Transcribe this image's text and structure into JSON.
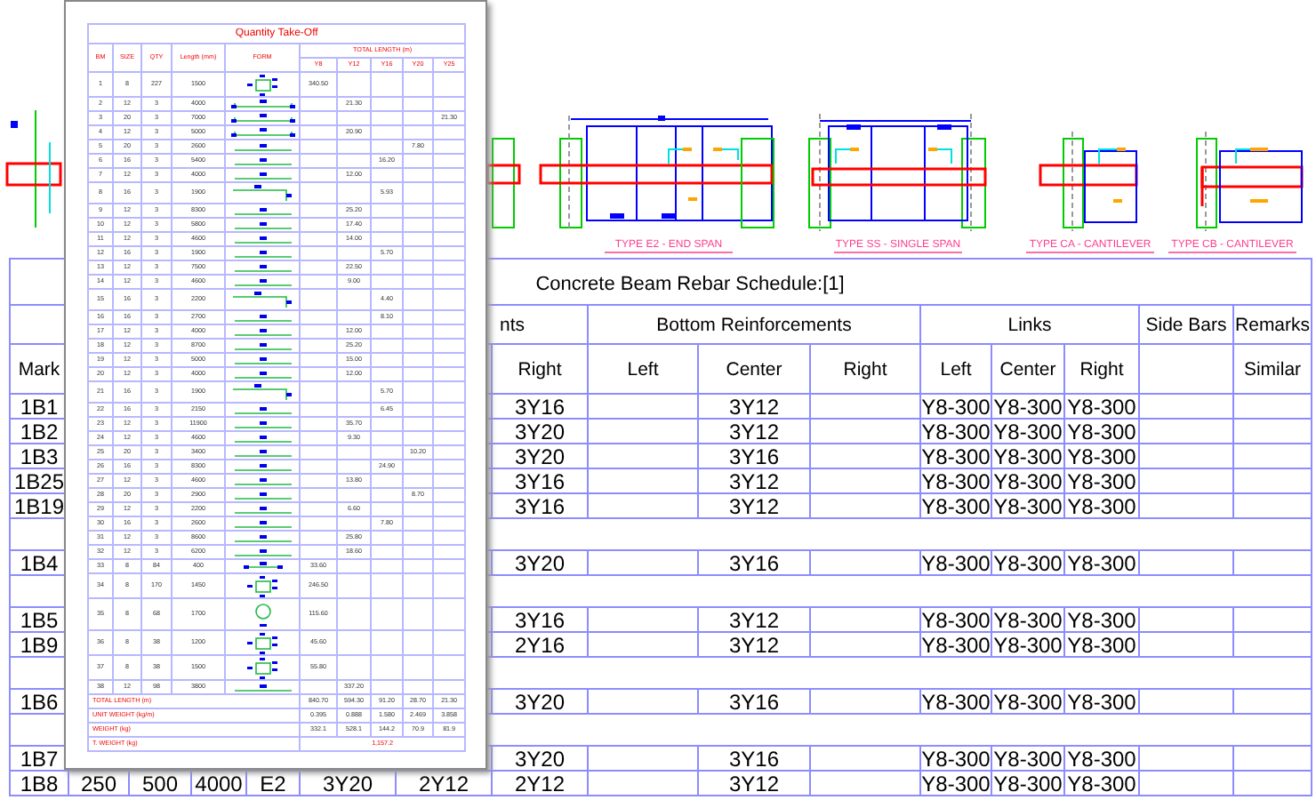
{
  "details": [
    {
      "label": "TYPE E2 - END SPAN"
    },
    {
      "label": "TYPE SS - SINGLE SPAN"
    },
    {
      "label": "TYPE CA - CANTILEVER"
    },
    {
      "label": "TYPE CB - CANTILEVER"
    }
  ],
  "schedule": {
    "title": "Concrete Beam Rebar Schedule:[1]",
    "group_headers": [
      "nts",
      "Bottom Reinforcements",
      "Links",
      "Side Bars",
      "Remarks"
    ],
    "column_headers": {
      "mark": "Mark",
      "top_right": "Right",
      "bottom_left": "Left",
      "bottom_center": "Center",
      "bottom_right": "Right",
      "links_left": "Left",
      "links_center": "Center",
      "links_right": "Right",
      "remarks": "Similar"
    },
    "rows": [
      {
        "kind": "data",
        "mark": "1B1",
        "top_right": "3Y16",
        "bottom_center": "3Y12",
        "links_left": "Y8-300",
        "links_center": "Y8-300",
        "links_right": "Y8-300"
      },
      {
        "kind": "data",
        "mark": "1B2",
        "top_right": "3Y20",
        "bottom_center": "3Y12",
        "links_left": "Y8-300",
        "links_center": "Y8-300",
        "links_right": "Y8-300"
      },
      {
        "kind": "data",
        "mark": "1B3",
        "top_right": "3Y20",
        "bottom_center": "3Y16",
        "links_left": "Y8-300",
        "links_center": "Y8-300",
        "links_right": "Y8-300"
      },
      {
        "kind": "data",
        "mark": "1B25",
        "top_right": "3Y16",
        "bottom_center": "3Y12",
        "links_left": "Y8-300",
        "links_center": "Y8-300",
        "links_right": "Y8-300"
      },
      {
        "kind": "data",
        "mark": "1B19",
        "top_right": "3Y16",
        "bottom_center": "3Y12",
        "links_left": "Y8-300",
        "links_center": "Y8-300",
        "links_right": "Y8-300"
      },
      {
        "kind": "spacer"
      },
      {
        "kind": "data",
        "mark": "1B4",
        "top_right": "3Y20",
        "bottom_center": "3Y16",
        "links_left": "Y8-300",
        "links_center": "Y8-300",
        "links_right": "Y8-300"
      },
      {
        "kind": "spacer"
      },
      {
        "kind": "data",
        "mark": "1B5",
        "top_right": "3Y16",
        "bottom_center": "3Y12",
        "links_left": "Y8-300",
        "links_center": "Y8-300",
        "links_right": "Y8-300"
      },
      {
        "kind": "data",
        "mark": "1B9",
        "top_right": "2Y16",
        "bottom_center": "3Y12",
        "links_left": "Y8-300",
        "links_center": "Y8-300",
        "links_right": "Y8-300"
      },
      {
        "kind": "spacer"
      },
      {
        "kind": "data",
        "mark": "1B6",
        "top_right": "3Y20",
        "bottom_center": "3Y16",
        "links_left": "Y8-300",
        "links_center": "Y8-300",
        "links_right": "Y8-300"
      },
      {
        "kind": "spacer"
      },
      {
        "kind": "data",
        "mark": "1B7",
        "top_right": "3Y20",
        "bottom_center": "3Y16",
        "links_left": "Y8-300",
        "links_center": "Y8-300",
        "links_right": "Y8-300"
      },
      {
        "kind": "data",
        "mark": "1B8",
        "column_2": "250",
        "column_3": "500",
        "column_4": "4000",
        "column_5": "E2",
        "column_6": "3Y20",
        "column_7": "2Y12",
        "top_right": "2Y12",
        "bottom_center": "3Y12",
        "links_left": "Y8-300",
        "links_center": "Y8-300",
        "links_right": "Y8-300"
      }
    ]
  },
  "takeoff": {
    "title": "Quantity Take-Off",
    "headers": [
      "BM",
      "SIZE",
      "QTY",
      "Length (mm)",
      "FORM"
    ],
    "total_header": "TOTAL LENGTH (m)",
    "bar_columns": [
      "Y8",
      "Y12",
      "Y16",
      "Y20",
      "Y25"
    ],
    "rows": [
      {
        "bm": "1",
        "size": "8",
        "qty": "227",
        "length": "1500",
        "kind": "stirrup",
        "y8": "340.50"
      },
      {
        "bm": "2",
        "size": "12",
        "qty": "3",
        "length": "4000",
        "kind": "bent",
        "y12": "21.30"
      },
      {
        "bm": "3",
        "size": "20",
        "qty": "3",
        "length": "7000",
        "kind": "bent",
        "y25": "21.30"
      },
      {
        "bm": "4",
        "size": "12",
        "qty": "3",
        "length": "5000",
        "kind": "bent",
        "y12": "20.90"
      },
      {
        "bm": "5",
        "size": "20",
        "qty": "3",
        "length": "2600",
        "kind": "straight",
        "y20": "7.80"
      },
      {
        "bm": "6",
        "size": "16",
        "qty": "3",
        "length": "5400",
        "kind": "straight",
        "y16": "16.20"
      },
      {
        "bm": "7",
        "size": "12",
        "qty": "3",
        "length": "4000",
        "kind": "straight",
        "y12": "12.00"
      },
      {
        "bm": "8",
        "size": "16",
        "qty": "3",
        "length": "1900",
        "kind": "hook",
        "y16": "5.93"
      },
      {
        "bm": "9",
        "size": "12",
        "qty": "3",
        "length": "8300",
        "kind": "straight",
        "y12": "25.20"
      },
      {
        "bm": "10",
        "size": "12",
        "qty": "3",
        "length": "5800",
        "kind": "straight",
        "y12": "17.40"
      },
      {
        "bm": "11",
        "size": "12",
        "qty": "3",
        "length": "4600",
        "kind": "straight",
        "y12": "14.00"
      },
      {
        "bm": "12",
        "size": "16",
        "qty": "3",
        "length": "1900",
        "kind": "straight",
        "y16": "5.70"
      },
      {
        "bm": "13",
        "size": "12",
        "qty": "3",
        "length": "7500",
        "kind": "straight",
        "y12": "22.50"
      },
      {
        "bm": "14",
        "size": "12",
        "qty": "3",
        "length": "4600",
        "kind": "straight",
        "y12": "9.00"
      },
      {
        "bm": "15",
        "size": "16",
        "qty": "3",
        "length": "2200",
        "kind": "hook",
        "y16": "4.40"
      },
      {
        "bm": "16",
        "size": "16",
        "qty": "3",
        "length": "2700",
        "kind": "straight",
        "y16": "8.10"
      },
      {
        "bm": "17",
        "size": "12",
        "qty": "3",
        "length": "4000",
        "kind": "straight",
        "y12": "12.00"
      },
      {
        "bm": "18",
        "size": "12",
        "qty": "3",
        "length": "8700",
        "kind": "straight",
        "y12": "25.20"
      },
      {
        "bm": "19",
        "size": "12",
        "qty": "3",
        "length": "5000",
        "kind": "straight",
        "y12": "15.00"
      },
      {
        "bm": "20",
        "size": "12",
        "qty": "3",
        "length": "4000",
        "kind": "straight",
        "y12": "12.00"
      },
      {
        "bm": "21",
        "size": "16",
        "qty": "3",
        "length": "1900",
        "kind": "hook",
        "y16": "5.70"
      },
      {
        "bm": "22",
        "size": "16",
        "qty": "3",
        "length": "2150",
        "kind": "straight",
        "y16": "6.45"
      },
      {
        "bm": "23",
        "size": "12",
        "qty": "3",
        "length": "11900",
        "kind": "straight",
        "y12": "35.70"
      },
      {
        "bm": "24",
        "size": "12",
        "qty": "3",
        "length": "4600",
        "kind": "straight",
        "y12": "9.30"
      },
      {
        "bm": "25",
        "size": "20",
        "qty": "3",
        "length": "3400",
        "kind": "straight",
        "y20": "10.20"
      },
      {
        "bm": "26",
        "size": "16",
        "qty": "3",
        "length": "8300",
        "kind": "straight",
        "y16": "24.90"
      },
      {
        "bm": "27",
        "size": "12",
        "qty": "3",
        "length": "4600",
        "kind": "straight",
        "y12": "13.80"
      },
      {
        "bm": "28",
        "size": "20",
        "qty": "3",
        "length": "2900",
        "kind": "straight",
        "y20": "8.70"
      },
      {
        "bm": "29",
        "size": "12",
        "qty": "3",
        "length": "2200",
        "kind": "straight",
        "y12": "6.60"
      },
      {
        "bm": "30",
        "size": "16",
        "qty": "3",
        "length": "2600",
        "kind": "straight",
        "y16": "7.80"
      },
      {
        "bm": "31",
        "size": "12",
        "qty": "3",
        "length": "8600",
        "kind": "straight",
        "y12": "25.80"
      },
      {
        "bm": "32",
        "size": "12",
        "qty": "3",
        "length": "6200",
        "kind": "straight",
        "y12": "18.60"
      },
      {
        "bm": "33",
        "size": "8",
        "qty": "84",
        "length": "400",
        "kind": "ties",
        "y8": "33.60"
      },
      {
        "bm": "34",
        "size": "8",
        "qty": "170",
        "length": "1450",
        "kind": "stirrup",
        "y8": "246.50"
      },
      {
        "bm": "35",
        "size": "8",
        "qty": "68",
        "length": "1700",
        "kind": "circle",
        "y8": "115.60"
      },
      {
        "bm": "36",
        "size": "8",
        "qty": "38",
        "length": "1200",
        "kind": "stirrup",
        "y8": "45.60"
      },
      {
        "bm": "37",
        "size": "8",
        "qty": "38",
        "length": "1500",
        "kind": "stirrup",
        "y8": "55.80"
      },
      {
        "bm": "38",
        "size": "12",
        "qty": "98",
        "length": "3800",
        "kind": "straight",
        "y12": "337.20"
      }
    ],
    "footer": [
      {
        "label": "TOTAL LENGTH (m)",
        "values": [
          "840.70",
          "594.30",
          "91.20",
          "28.70",
          "21.30"
        ]
      },
      {
        "label": "UNIT WEIGHT (kg/m)",
        "values": [
          "0.395",
          "0.888",
          "1.580",
          "2.469",
          "3.858"
        ]
      },
      {
        "label": "WEIGHT (kg)",
        "values": [
          "332.1",
          "528.1",
          "144.2",
          "70.9",
          "81.9"
        ]
      },
      {
        "label": "T. WEIGHT (kg)",
        "total": "1,157.2"
      }
    ]
  }
}
